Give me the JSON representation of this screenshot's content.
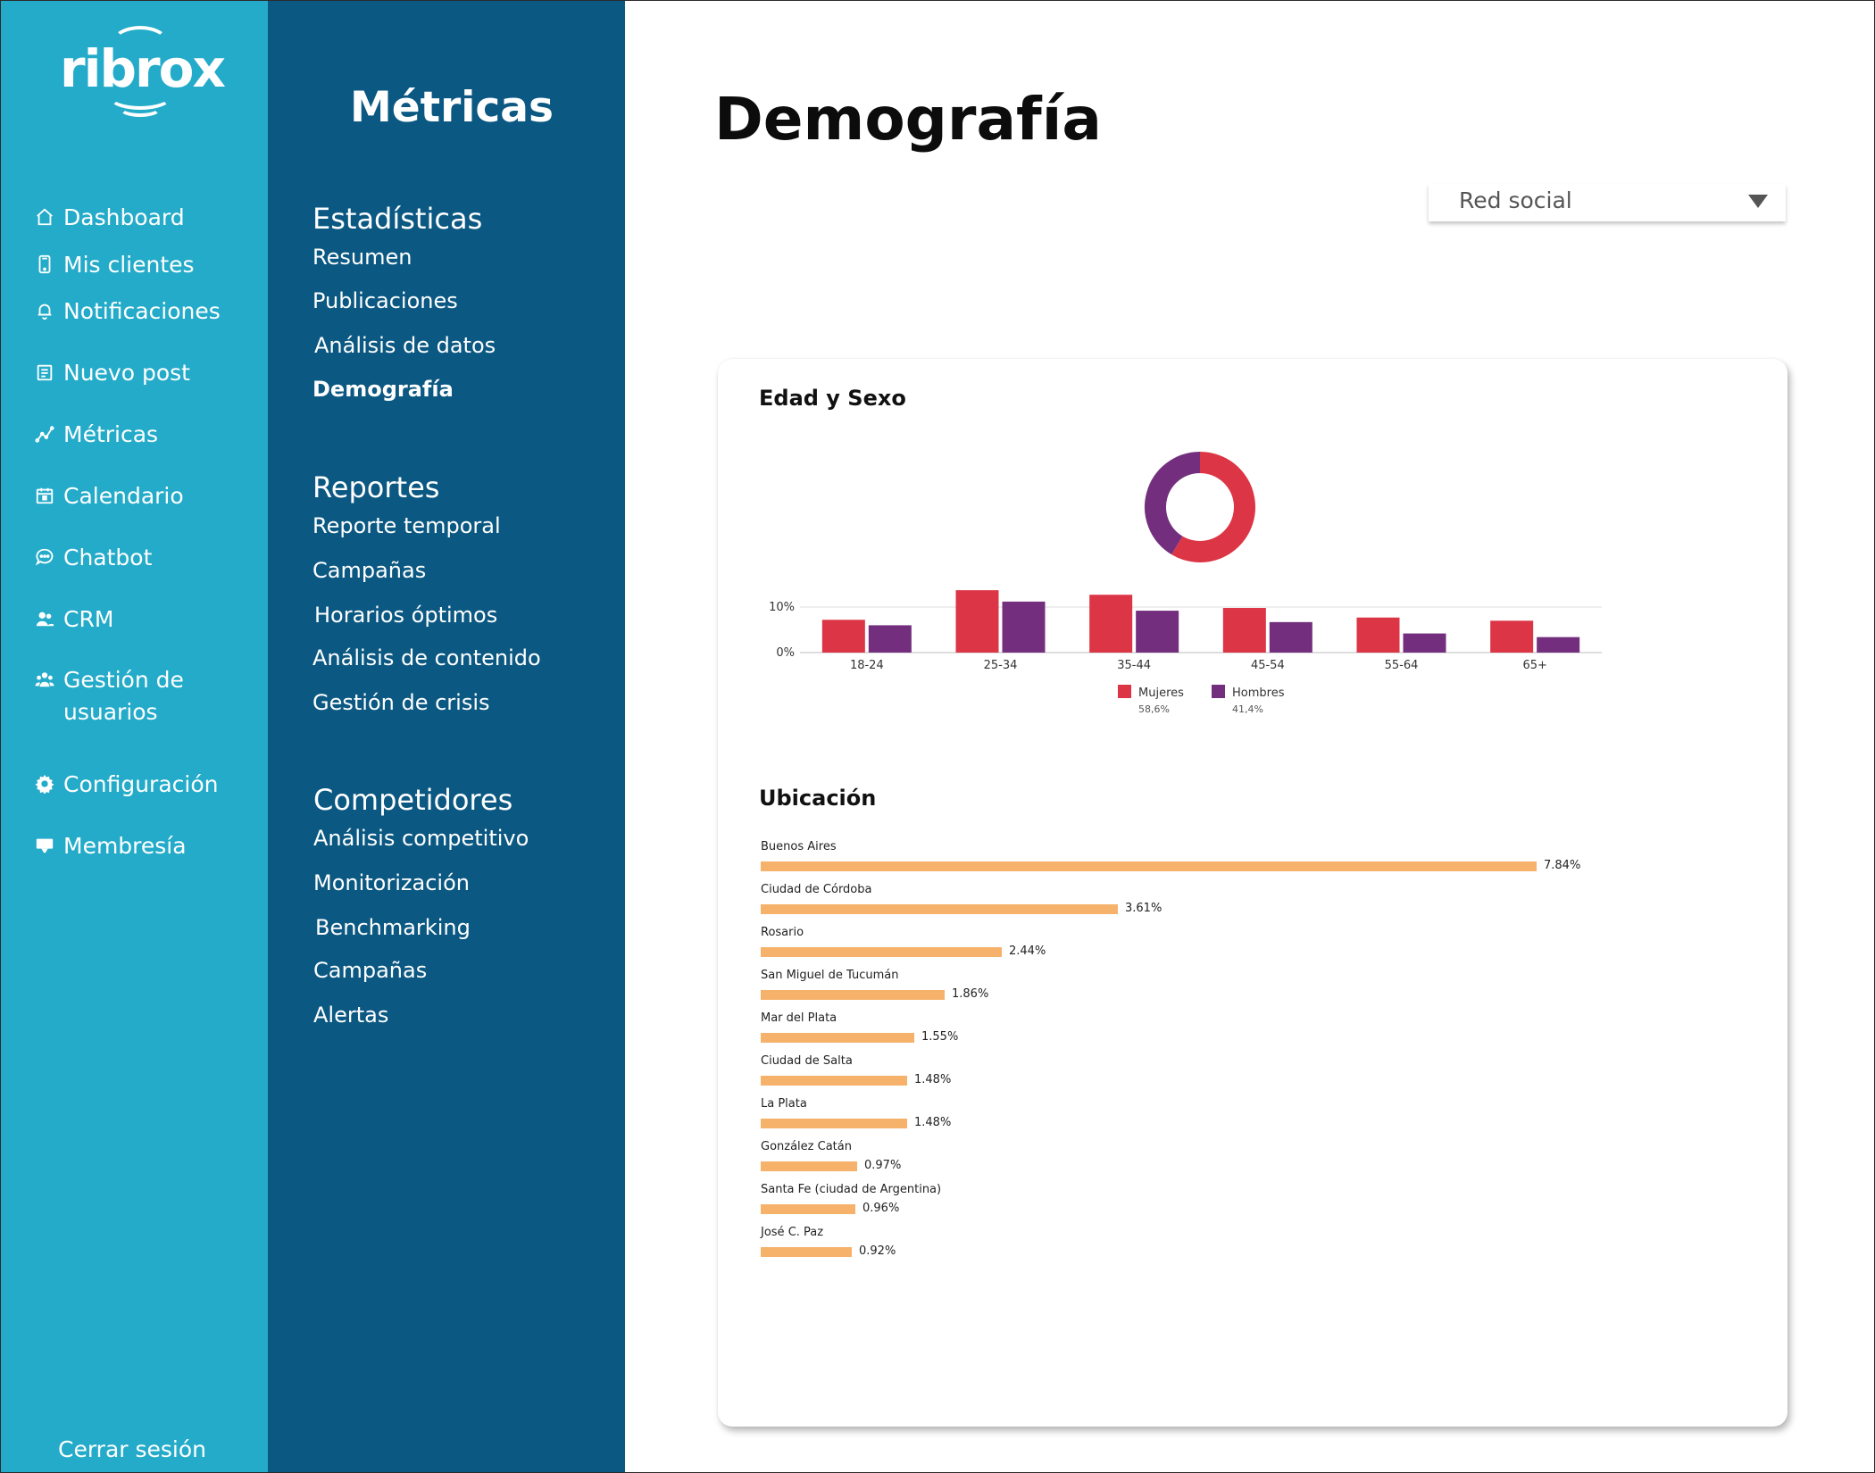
{
  "brand": {
    "logo_text": "ribrox"
  },
  "sidebar": {
    "items": [
      {
        "label": "Dashboard",
        "icon": "home-icon"
      },
      {
        "label": "Mis clientes",
        "icon": "phone-icon"
      },
      {
        "label": "Notificaciones",
        "icon": "bell-icon"
      },
      {
        "label": "Nuevo post",
        "icon": "post-icon"
      },
      {
        "label": "Métricas",
        "icon": "metrics-icon"
      },
      {
        "label": "Calendario",
        "icon": "calendar-icon"
      },
      {
        "label": "Chatbot",
        "icon": "chat-icon"
      },
      {
        "label": "CRM",
        "icon": "users-icon"
      },
      {
        "label": "Gestión de usuarios",
        "icon": "team-icon"
      },
      {
        "label": "Configuración",
        "icon": "gear-icon"
      },
      {
        "label": "Membresía",
        "icon": "membership-icon"
      }
    ],
    "logout": "Cerrar sesión"
  },
  "subnav": {
    "title": "Métricas",
    "sections": [
      {
        "heading": "Estadísticas",
        "links": [
          "Resumen",
          "Publicaciones",
          "Análisis de datos",
          "Demografía"
        ],
        "active": "Demografía"
      },
      {
        "heading": "Reportes",
        "links": [
          "Reporte temporal",
          "Campañas",
          "Horarios óptimos",
          "Análisis de contenido",
          "Gestión de crisis"
        ]
      },
      {
        "heading": "Competidores",
        "links": [
          "Análisis competitivo",
          "Monitorización",
          "Benchmarking",
          "Campañas",
          "Alertas"
        ]
      }
    ]
  },
  "main": {
    "title": "Demografía",
    "filter": {
      "label": "Red social"
    },
    "age_sex_title": "Edad y Sexo",
    "location_title": "Ubicación"
  },
  "colors": {
    "women": "#dc3545",
    "men": "#732f7e",
    "location_bar": "#f6b26b",
    "sidebar": "#24abc9",
    "subbar": "#0b5882"
  },
  "chart_data": [
    {
      "type": "pie",
      "title": "",
      "donut": true,
      "labels": [
        "Mujeres",
        "Hombres"
      ],
      "values": [
        58.6,
        41.4
      ],
      "colors": [
        "#dc3545",
        "#732f7e"
      ]
    },
    {
      "type": "bar",
      "title": "",
      "categories": [
        "18-24",
        "25-34",
        "35-44",
        "45-54",
        "55-64",
        "65+"
      ],
      "series": [
        {
          "name": "Mujeres",
          "share": "58,6%",
          "color": "#dc3545",
          "values": [
            7.2,
            13.7,
            12.7,
            9.8,
            7.7,
            7.0
          ]
        },
        {
          "name": "Hombres",
          "share": "41,4%",
          "color": "#732f7e",
          "values": [
            6.0,
            11.2,
            9.2,
            6.7,
            4.2,
            3.4
          ]
        }
      ],
      "yticks": [
        "0%",
        "10%"
      ],
      "ylim": [
        0,
        15
      ],
      "legend": "bottom-center",
      "grid": true
    },
    {
      "type": "bar",
      "orientation": "horizontal",
      "title": "",
      "categories": [
        "Buenos Aires",
        "Ciudad de Córdoba",
        "Rosario",
        "San Miguel de Tucumán",
        "Mar del Plata",
        "Ciudad de Salta",
        "La Plata",
        "González Catán",
        "Santa Fe (ciudad de Argentina)",
        "José C. Paz"
      ],
      "values": [
        7.84,
        3.61,
        2.44,
        1.86,
        1.55,
        1.48,
        1.48,
        0.97,
        0.96,
        0.92
      ],
      "labels": [
        "7.84%",
        "3.61%",
        "2.44%",
        "1.86%",
        "1.55%",
        "1.48%",
        "1.48%",
        "0.97%",
        "0.96%",
        "0.92%"
      ],
      "xlim": [
        0,
        7.84
      ]
    }
  ]
}
